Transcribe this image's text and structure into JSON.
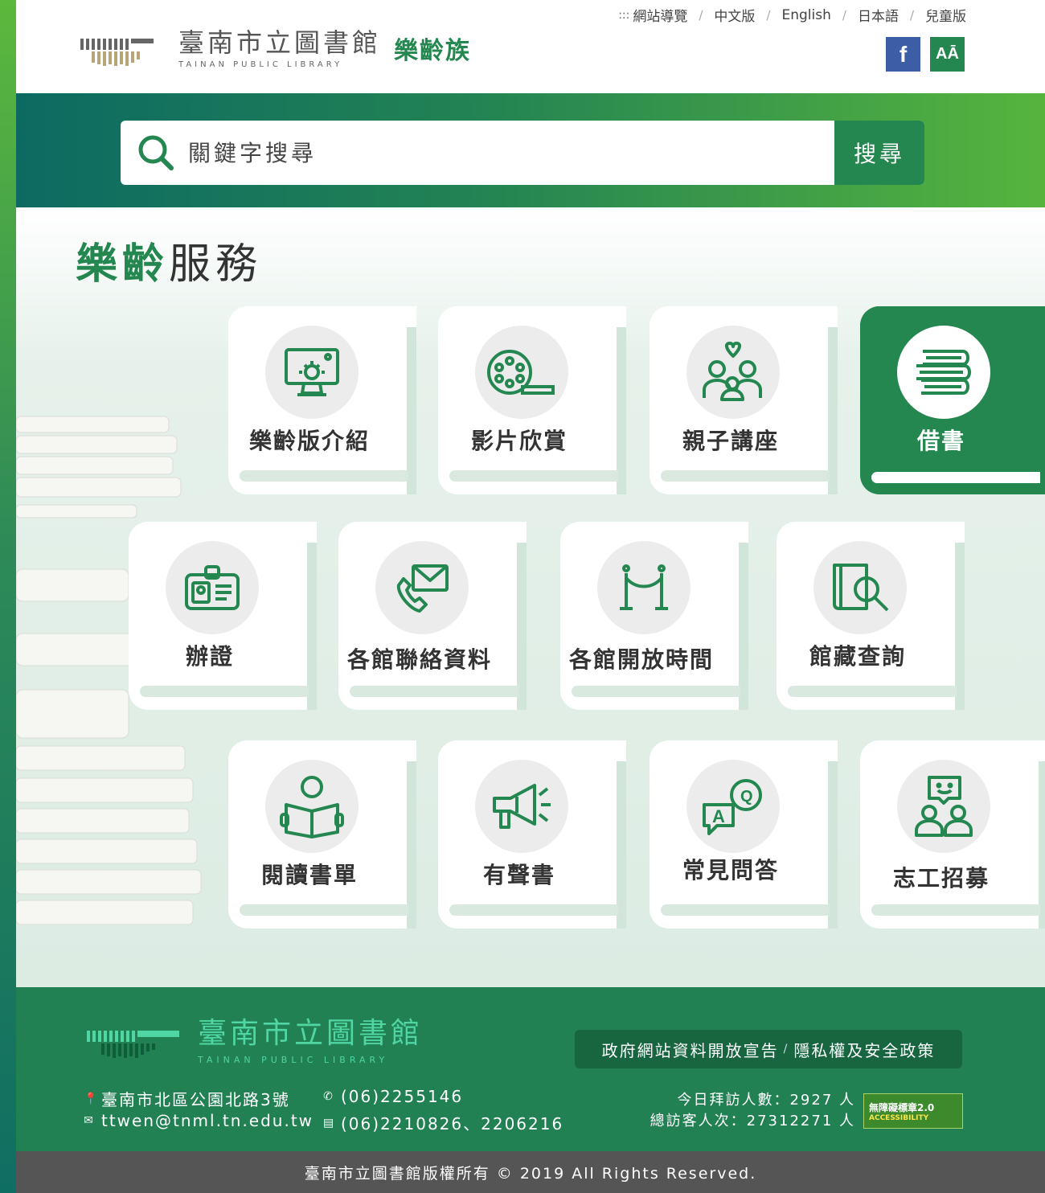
{
  "header": {
    "logo_cn": "臺南市立圖書館",
    "logo_en": "TAINAN PUBLIC LIBRARY",
    "logo_sub": "樂齡族",
    "access_key": ":::",
    "nav": [
      "網站導覽",
      "中文版",
      "English",
      "日本語",
      "兒童版"
    ],
    "facebook_label": "f",
    "font_size_label": "AĀ"
  },
  "search": {
    "placeholder": "關鍵字搜尋",
    "button_label": "搜尋"
  },
  "services": {
    "title_highlight": "樂齡",
    "title_rest": "服務",
    "items": [
      {
        "label": "樂齡版介紹",
        "icon": "monitor-gear-icon"
      },
      {
        "label": "影片欣賞",
        "icon": "film-reel-icon"
      },
      {
        "label": "親子講座",
        "icon": "family-heart-icon"
      },
      {
        "label": "借書",
        "icon": "book-stack-icon"
      },
      {
        "label": "辦證",
        "icon": "id-card-icon"
      },
      {
        "label": "各館聯絡資料",
        "icon": "phone-mail-icon"
      },
      {
        "label": "各館開放時間",
        "icon": "rope-barrier-icon"
      },
      {
        "label": "館藏查詢",
        "icon": "book-search-icon"
      },
      {
        "label": "閱讀書單",
        "icon": "reader-icon"
      },
      {
        "label": "有聲書",
        "icon": "megaphone-icon"
      },
      {
        "label": "常見問答",
        "icon": "qa-bubbles-icon"
      },
      {
        "label": "志工招募",
        "icon": "volunteers-icon"
      }
    ],
    "active_index": 3
  },
  "footer": {
    "logo_cn": "臺南市立圖書館",
    "logo_en": "TAINAN PUBLIC LIBRARY",
    "policy_open_data": "政府網站資料開放宣告",
    "policy_sep": "/",
    "policy_privacy": "隱私權及安全政策",
    "address": "臺南市北區公園北路3號",
    "email": "ttwen@tnml.tn.edu.tw",
    "phone": "(06)2255146",
    "fax": "(06)2210826、2206216",
    "visitors_today": "今日拜訪人數：2927 人",
    "visitors_total": "總訪客人次：27312271 人",
    "badge_top": "無障礙標章2.0",
    "badge_bottom": "ACCESSIBILITY",
    "copyright": "臺南市立圖書館版權所有 © 2019 All Rights Reserved."
  },
  "colors": {
    "brand_green": "#23874f",
    "dark_teal": "#0c6a62",
    "light_green": "#56b43d",
    "footer_green": "#218153",
    "copyright_gray": "#555555"
  }
}
